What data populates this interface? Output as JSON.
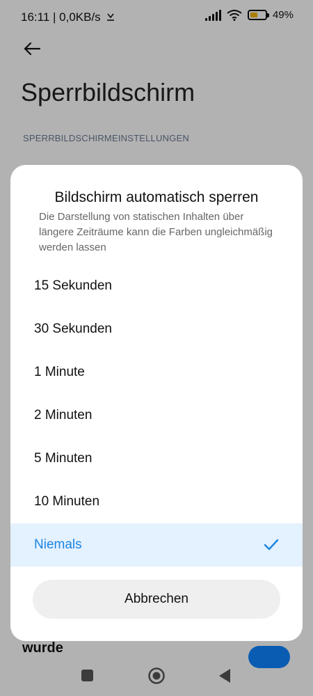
{
  "status_bar": {
    "time_speed": "16:11 | 0,0KB/s",
    "battery_percent": "49%",
    "battery_level": 0.49,
    "battery_color": "#f5b400"
  },
  "header": {
    "title": "Sperrbildschirm"
  },
  "section": {
    "header": "SPERRBILDSCHIRMEINSTELLUNGEN"
  },
  "background_item": {
    "text": "wurde",
    "toggle_color": "#0d84ff"
  },
  "dialog": {
    "title": "Bildschirm automatisch sperren",
    "description": "Die Darstellung von statischen Inhalten über längere Zeiträume kann die Farben ungleichmäßig werden lassen",
    "options": [
      {
        "label": "15 Sekunden"
      },
      {
        "label": "30 Sekunden"
      },
      {
        "label": "1 Minute"
      },
      {
        "label": "2 Minuten"
      },
      {
        "label": "5 Minuten"
      },
      {
        "label": "10 Minuten"
      },
      {
        "label": "Niemals"
      }
    ],
    "selected_index": 6,
    "accent_color": "#1a85e4",
    "cancel_label": "Abbrechen"
  },
  "icons": {
    "back": "arrow-left-icon",
    "check": "checkmark-icon",
    "nav_recents": "square-icon",
    "nav_home": "circle-home-icon",
    "nav_back": "triangle-back-icon"
  }
}
